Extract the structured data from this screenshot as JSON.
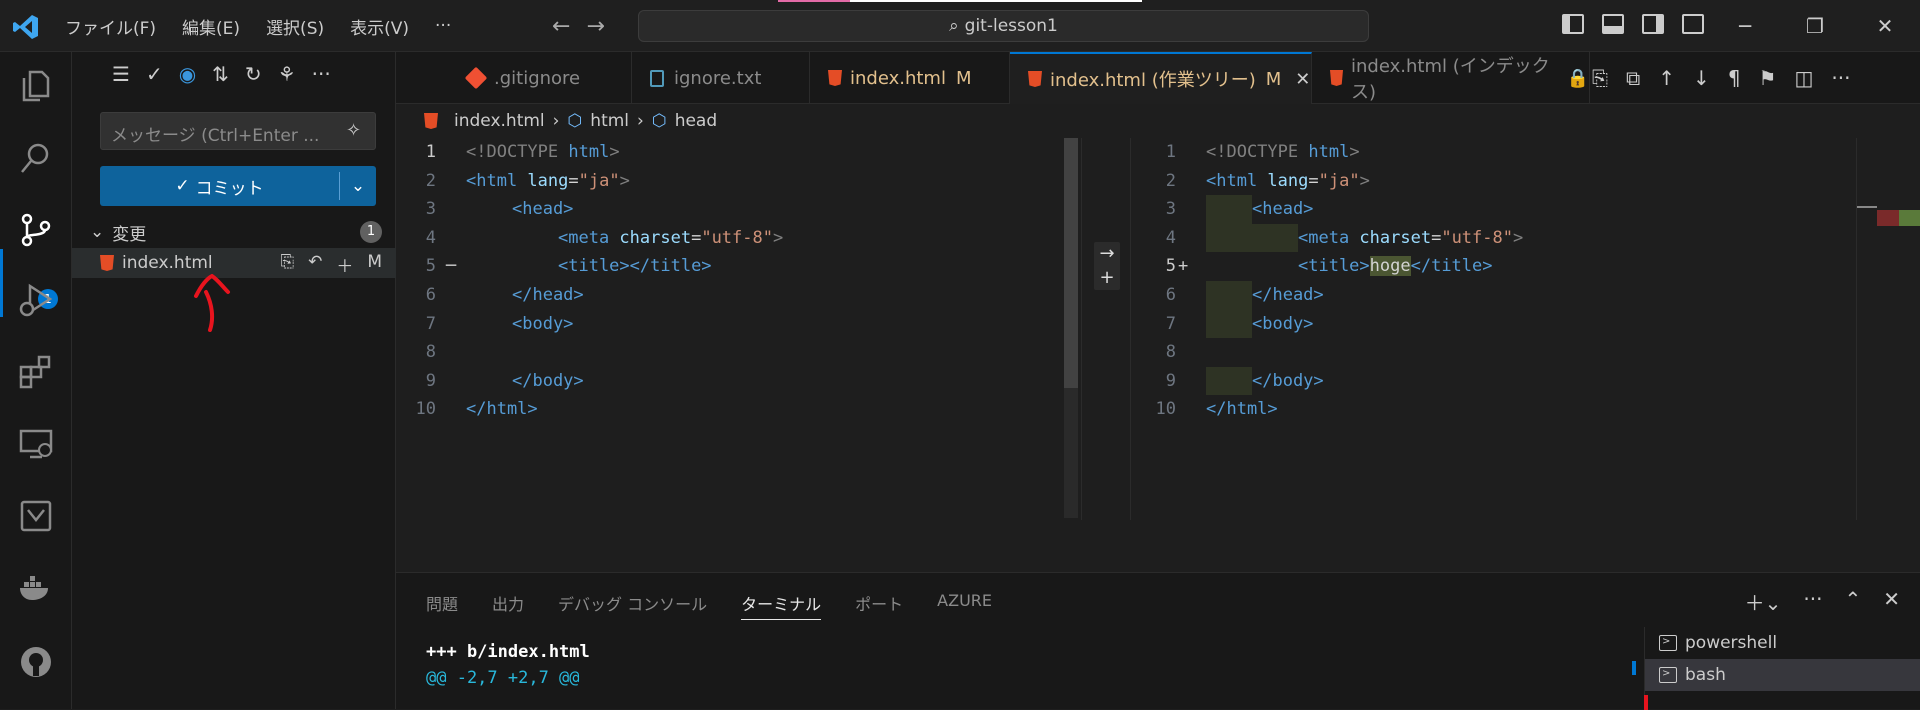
{
  "titlebar": {
    "menus": [
      "ファイル(F)",
      "編集(E)",
      "選択(S)",
      "表示(V)",
      "···"
    ],
    "search_text": "git-lesson1",
    "window_controls": [
      "─",
      "❐",
      "✕"
    ]
  },
  "activity": {
    "scm_badge": "1"
  },
  "sidebar": {
    "message_placeholder": "メッセージ (Ctrl+Enter ...",
    "commit_label": "コミット",
    "changes_label": "変更",
    "changes_count": "1",
    "file": {
      "name": "index.html",
      "status": "M"
    }
  },
  "tabs": [
    {
      "label": ".gitignore",
      "icon": "git-icon"
    },
    {
      "label": "ignore.txt",
      "icon": "file-icon"
    },
    {
      "label": "index.html",
      "mod": "M",
      "icon": "html-icon"
    },
    {
      "label": "index.html (作業ツリー)",
      "mod": "M",
      "close": "✕",
      "icon": "html-icon",
      "active": true
    },
    {
      "label": "index.html (インデックス)",
      "icon": "html-icon"
    }
  ],
  "breadcrumb": [
    "index.html",
    "html",
    "head"
  ],
  "left_lines": [
    "1",
    "2",
    "3",
    "4",
    "5",
    "6",
    "7",
    "8",
    "9",
    "10"
  ],
  "right_lines": [
    "1",
    "2",
    "3",
    "4",
    "5",
    "6",
    "7",
    "8",
    "9",
    "10"
  ],
  "left_marker": "─",
  "right_marker": "+",
  "code": {
    "doctype": "<!DOCTYPE",
    "html_kw": " html",
    "gt": ">",
    "html_open": "<html",
    "lang": " lang",
    "eq": "=",
    "ja": "\"ja\"",
    "head_open": "<head>",
    "meta": "<meta",
    "charset": " charset",
    "utf8": "\"utf-8\"",
    "title_open": "<title>",
    "title_close": "</title>",
    "hoge": "hoge",
    "head_close": "</head>",
    "body_open": "<body>",
    "body_close": "</body>",
    "html_close": "</html>"
  },
  "panel": {
    "tabs": [
      "問題",
      "出力",
      "デバッグ コンソール",
      "ターミナル",
      "ポート",
      "AZURE"
    ],
    "active_tab": "ターミナル",
    "term_line1": "+++ b/index.html",
    "term_line2": "@@ -2,7 +2,7 @@",
    "terminals": [
      "powershell",
      "bash"
    ]
  },
  "colors": {
    "accent": "#0078d4",
    "deleted": "#4b1818",
    "added": "#373d29",
    "annotation": "#e8141e"
  }
}
